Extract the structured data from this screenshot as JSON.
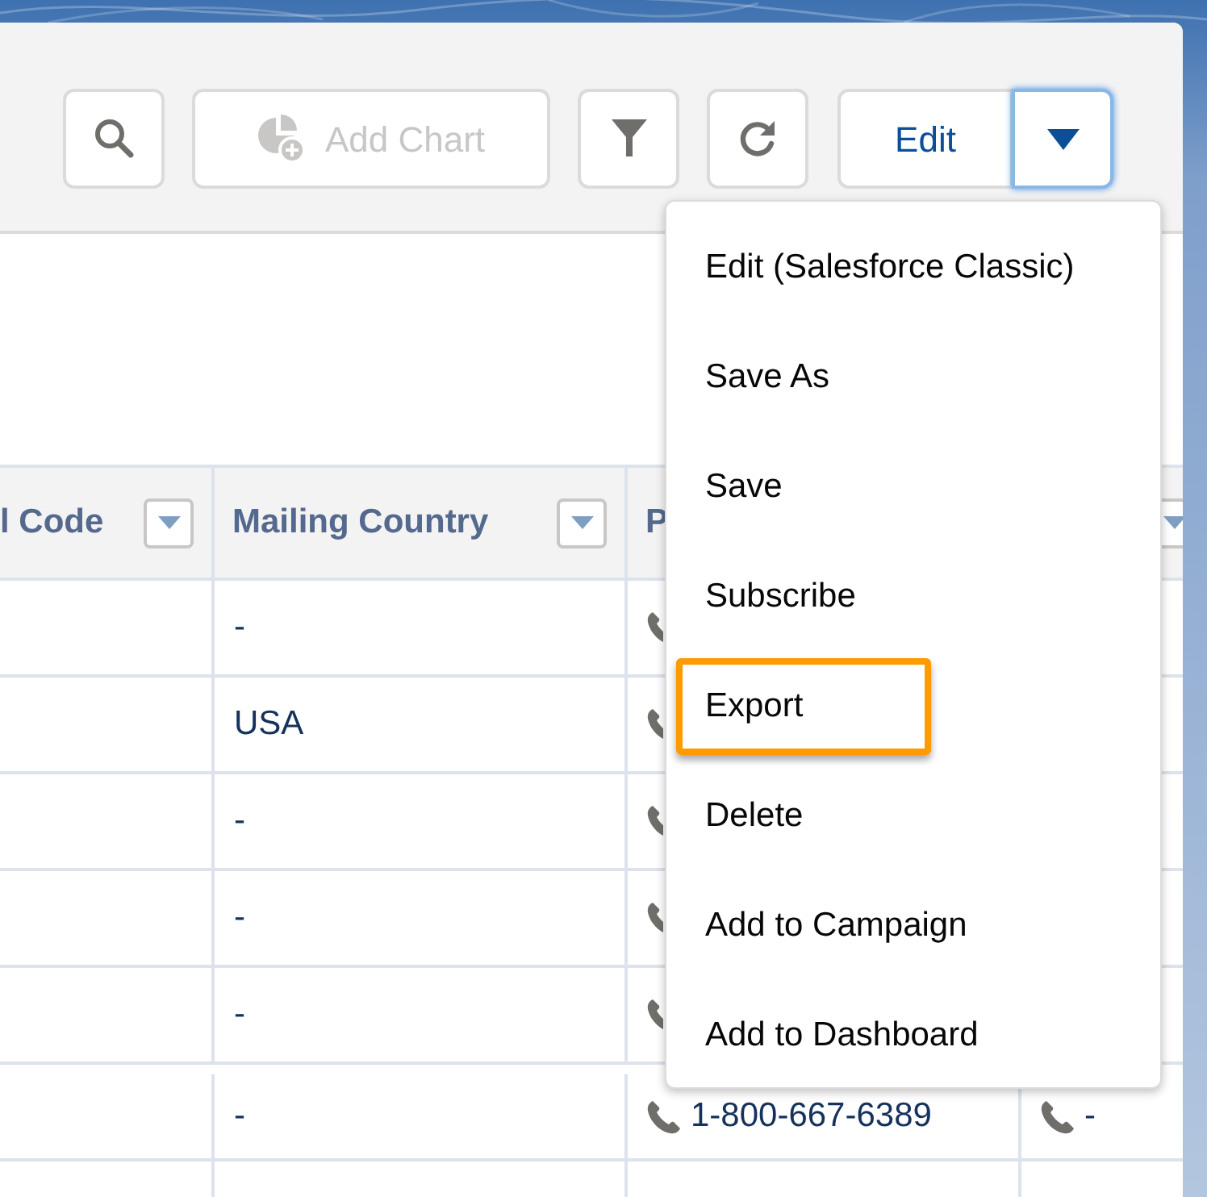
{
  "toolbar": {
    "buttons": [
      {
        "kind": "search",
        "disabled": false
      },
      {
        "kind": "add_chart",
        "label": "Add Chart",
        "disabled": true
      },
      {
        "kind": "filter",
        "disabled": false
      },
      {
        "kind": "refresh",
        "disabled": false
      }
    ],
    "edit_button": {
      "label": "Edit"
    },
    "menu_button": {
      "expanded": true
    }
  },
  "menu": {
    "items": [
      {
        "label": "Edit (Salesforce Classic)",
        "highlighted": false
      },
      {
        "label": "Save As",
        "highlighted": false
      },
      {
        "label": "Save",
        "highlighted": false
      },
      {
        "label": "Subscribe",
        "highlighted": false
      },
      {
        "label": "Export",
        "highlighted": true
      },
      {
        "label": "Delete",
        "highlighted": false
      },
      {
        "label": "Add to Campaign",
        "highlighted": false
      },
      {
        "label": "Add to Dashboard",
        "highlighted": false
      }
    ]
  },
  "table": {
    "columns": [
      {
        "label": "l Code",
        "filter_button": true
      },
      {
        "label": "Mailing Country",
        "filter_button": true
      },
      {
        "label": "P",
        "filter_button": false
      },
      {
        "filter_button": true
      }
    ],
    "rows": [
      {
        "mailing_country": "-",
        "phone_1": {
          "icon": true
        },
        "phone_2": {
          "icon": false
        }
      },
      {
        "mailing_country": "USA",
        "phone_1": {
          "icon": true
        },
        "phone_2": {
          "icon": false
        }
      },
      {
        "mailing_country": "-",
        "phone_1": {
          "icon": true
        },
        "phone_2": {
          "icon": false
        }
      },
      {
        "mailing_country": "-",
        "phone_1": {
          "icon": true
        },
        "phone_2": {
          "icon": false
        }
      },
      {
        "mailing_country": "-",
        "phone_1": {
          "icon": true
        },
        "phone_2": {
          "icon": false
        }
      },
      {
        "mailing_country": "-",
        "phone_1": {
          "icon": true,
          "number": "1-800-667-6389"
        },
        "phone_2": {
          "icon": true,
          "number": "-"
        }
      }
    ]
  }
}
